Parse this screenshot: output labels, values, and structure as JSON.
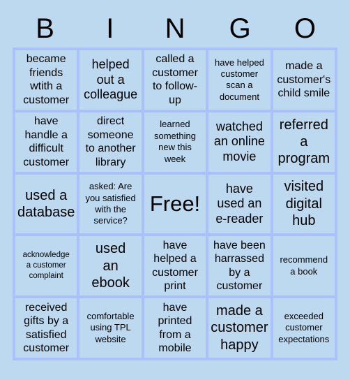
{
  "card": {
    "header_letters": [
      "B",
      "I",
      "N",
      "G",
      "O"
    ],
    "colors": {
      "background": "#bcd9f0",
      "cell_fill": "#bcd9f0",
      "grid_line": "#a9c0fa",
      "text": "#000000"
    },
    "rows": [
      [
        {
          "text": "became\nfriends\nwtith a\ncustomer",
          "size": "md"
        },
        {
          "text": "helped\nout a\ncolleague",
          "size": "lg"
        },
        {
          "text": "called a\ncustomer\nto follow-\nup",
          "size": "md"
        },
        {
          "text": "have helped\ncustomer\nscan a\ndocument",
          "size": "sm"
        },
        {
          "text": "made a\ncustomer's\nchild smile",
          "size": "md"
        }
      ],
      [
        {
          "text": "have\nhandle a\ndifficult\ncustomer",
          "size": "md"
        },
        {
          "text": "direct\nsomeone\nto another\nlibrary",
          "size": "md"
        },
        {
          "text": "learned\nsomething\nnew this\nweek",
          "size": "sm"
        },
        {
          "text": "watched\nan online\nmovie",
          "size": "lg"
        },
        {
          "text": "referred\na\nprogram",
          "size": "xl"
        }
      ],
      [
        {
          "text": "used a\ndatabase",
          "size": "xl"
        },
        {
          "text": "asked: Are\nyou satisfied\nwith the\nservice?",
          "size": "sm"
        },
        {
          "text": "Free!",
          "size": "free"
        },
        {
          "text": "have\nused an\ne-reader",
          "size": "lg"
        },
        {
          "text": "visited\ndigital\nhub",
          "size": "xl"
        }
      ],
      [
        {
          "text": "acknowledge\na customer\ncomplaint",
          "size": "xs"
        },
        {
          "text": "used\nan\nebook",
          "size": "xl"
        },
        {
          "text": "have\nhelped a\ncustomer\nprint",
          "size": "md"
        },
        {
          "text": "have been\nharrassed\nby a\ncustomer",
          "size": "md"
        },
        {
          "text": "recommend\na book",
          "size": "sm"
        }
      ],
      [
        {
          "text": "received\ngifts by a\nsatisfied\ncustomer",
          "size": "md"
        },
        {
          "text": "comfortable\nusing TPL\nwebsite",
          "size": "sm"
        },
        {
          "text": "have\nprinted\nfrom a\nmobile",
          "size": "md"
        },
        {
          "text": "made a\ncustomer\nhappy",
          "size": "xl"
        },
        {
          "text": "exceeded\ncustomer\nexpectations",
          "size": "sm"
        }
      ]
    ]
  }
}
